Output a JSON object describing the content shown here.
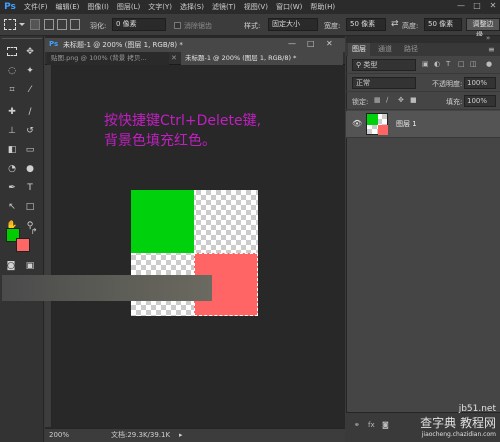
{
  "app": {
    "logo": "Ps"
  },
  "menu": [
    "文件(F)",
    "编辑(E)",
    "图像(I)",
    "图层(L)",
    "文字(Y)",
    "选择(S)",
    "滤镜(T)",
    "视图(V)",
    "窗口(W)",
    "帮助(H)"
  ],
  "window_controls": [
    "—",
    "□",
    "✕"
  ],
  "options": {
    "feather_label": "羽化:",
    "feather_value": "0 像素",
    "antialias_label": "消除锯齿",
    "style_label": "样式:",
    "style_value": "固定大小",
    "width_label": "宽度:",
    "width_value": "50 像素",
    "swap_icon": "⇄",
    "height_label": "高度:",
    "height_value": "50 像素",
    "refine_button": "调整边缘..."
  },
  "document": {
    "title": "未标题-1 @ 200% (图层 1, RGB/8) *",
    "tabs": [
      {
        "label": "贴图.png @ 100% (背景 拷贝..."
      },
      {
        "label": "未标题-1 @ 200% (图层 1, RGB/8) *"
      }
    ],
    "annotation_line1": "按快捷键Ctrl+Delete键,",
    "annotation_line2": "背景色填充红色。"
  },
  "colors": {
    "foreground": "#00cc00",
    "background": "#ff6666",
    "annotation": "#c11fc1",
    "fill_green": "#00d10d",
    "fill_red": "#ff6565"
  },
  "status": {
    "zoom": "200%",
    "doc_size": "文档:29.3K/39.1K"
  },
  "layers_panel": {
    "tabs": [
      "图层",
      "通道",
      "路径"
    ],
    "filter_label": "类型",
    "blend_mode": "正常",
    "opacity_label": "不透明度:",
    "opacity_value": "100%",
    "lock_label": "锁定:",
    "fill_label": "填充:",
    "fill_value": "100%",
    "layer_name": "图层 1"
  },
  "watermark": {
    "line1": "jb51.net",
    "line2": "查字典 教程网",
    "line3": "jiaocheng.chazidian.com"
  }
}
